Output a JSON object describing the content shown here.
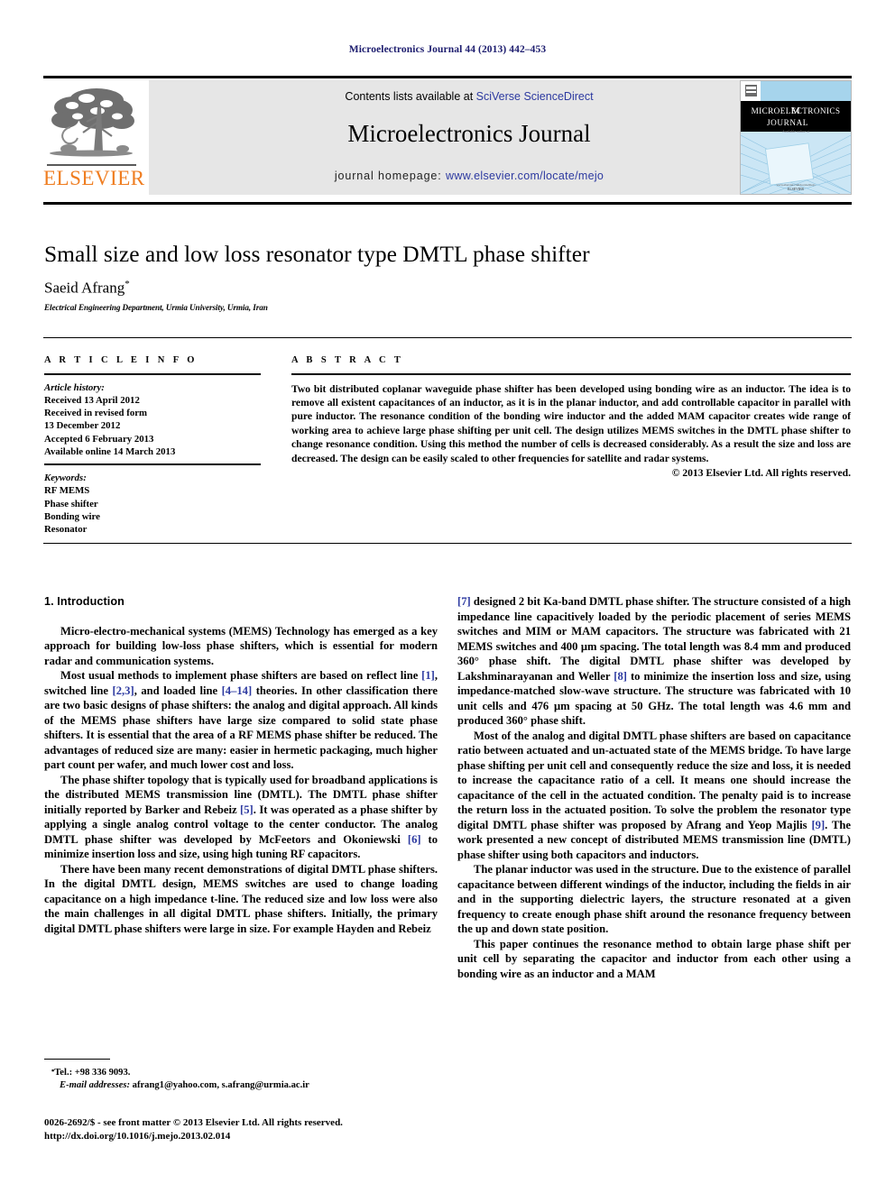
{
  "running_head": "Microelectronics Journal 44 (2013) 442–453",
  "masthead": {
    "publisher_name": "ELSEVIER",
    "contents_prefix": "Contents lists available at ",
    "contents_link": "SciVerse ScienceDirect",
    "journal_title": "Microelectronics Journal",
    "homepage_prefix": "journal homepage: ",
    "homepage_link": "www.elsevier.com/locate/mejo",
    "cover_title_line1": "MICROELECTRONICS",
    "cover_title_line2": "JOURNAL"
  },
  "article": {
    "title": "Small size and low loss resonator type DMTL phase shifter",
    "author": "Saeid Afrang",
    "author_marker": "*",
    "affiliation": "Electrical Engineering Department, Urmia University, Urmia, Iran"
  },
  "info": {
    "heading": "A R T I C L E   I N F O",
    "history_label": "Article history:",
    "history": [
      "Received 13 April 2012",
      "Received in revised form",
      "13 December 2012",
      "Accepted 6 February 2013",
      "Available online 14 March 2013"
    ],
    "keywords_label": "Keywords:",
    "keywords": [
      "RF MEMS",
      "Phase shifter",
      "Bonding wire",
      "Resonator"
    ]
  },
  "abstract": {
    "heading": "A B S T R A C T",
    "text": "Two bit distributed coplanar waveguide phase shifter has been developed using bonding wire as an inductor. The idea is to remove all existent capacitances of an inductor, as it is in the planar inductor, and add controllable capacitor in parallel with pure inductor. The resonance condition of the bonding wire inductor and the added MAM capacitor creates wide range of working area to achieve large phase shifting per unit cell. The design utilizes MEMS switches in the DMTL phase shifter to change resonance condition. Using this method the number of cells is decreased considerably. As a result the size and loss are decreased. The design can be easily scaled to other frequencies for satellite and radar systems.",
    "copyright": "© 2013 Elsevier Ltd. All rights reserved."
  },
  "body": {
    "section_number_title": "1.  Introduction",
    "left_paragraphs": [
      "Micro-electro-mechanical systems (MEMS) Technology has emerged as a key approach for building low-loss phase shifters, which is essential for modern radar and communication systems.",
      "Most usual methods to implement phase shifters are based on reflect line [1], switched line [2,3], and loaded line [4–14] theories. In other classification there are two basic designs of phase shifters: the analog and digital approach. All kinds of the MEMS phase shifters have large size compared to solid state phase shifters. It is essential that the area of a RF MEMS phase shifter be reduced. The advantages of reduced size are many: easier in hermetic packaging, much higher part count per wafer, and much lower cost and loss.",
      "The phase shifter topology that is typically used for broadband applications is the distributed MEMS transmission line (DMTL). The DMTL phase shifter initially reported by Barker and Rebeiz [5]. It was operated as a phase shifter by applying a single analog control voltage to the center conductor. The analog DMTL phase shifter was developed by McFeetors and Okoniewski [6] to minimize insertion loss and size, using high tuning RF capacitors.",
      "There have been many recent demonstrations of digital DMTL phase shifters. In the digital DMTL design, MEMS switches are used to change loading capacitance on a high impedance t-line. The reduced size and low loss were also the main challenges in all digital DMTL phase shifters. Initially, the primary digital DMTL phase shifters were large in size. For example Hayden and Rebeiz"
    ],
    "right_paragraphs": [
      "[7] designed 2 bit Ka-band DMTL phase shifter. The structure consisted of a high impedance line capacitively loaded by the periodic placement of series MEMS switches and MIM or MAM capacitors. The structure was fabricated with 21 MEMS switches and 400 μm spacing. The total length was 8.4 mm and produced 360° phase shift. The digital DMTL phase shifter was developed by Lakshminarayanan and Weller [8] to minimize the insertion loss and size, using impedance-matched slow-wave structure. The structure was fabricated with 10 unit cells and 476 μm spacing at 50 GHz. The total length was 4.6 mm and produced 360° phase shift.",
      "Most of the analog and digital DMTL phase shifters are based on capacitance ratio between actuated and un-actuated state of the MEMS bridge. To have large phase shifting per unit cell and consequently reduce the size and loss, it is needed to increase the capacitance ratio of a cell. It means one should increase the capacitance of the cell in the actuated condition. The penalty paid is to increase the return loss in the actuated position. To solve the problem the resonator type digital DMTL phase shifter was proposed by Afrang and Yeop Majlis [9]. The work presented a new concept of distributed MEMS transmission line (DMTL) phase shifter using both capacitors and inductors.",
      "The planar inductor was used in the structure. Due to the existence of parallel capacitance between different windings of the inductor, including the fields in air and in the supporting dielectric layers, the structure resonated at a given frequency to create enough phase shift around the resonance frequency between the up and down state position.",
      "This paper continues the resonance method to obtain large phase shift per unit cell by separating the capacitor and inductor from each other using a bonding wire as an inductor and a MAM"
    ]
  },
  "footnotes": {
    "tel": "Tel.: +98 336 9093.",
    "email_label": "E-mail addresses:",
    "emails": "afrang1@yahoo.com, s.afrang@urmia.ac.ir",
    "issn_line": "0026-2692/$ - see front matter © 2013 Elsevier Ltd. All rights reserved.",
    "doi_line": "http://dx.doi.org/10.1016/j.mejo.2013.02.014"
  },
  "colors": {
    "link": "#2c39a0",
    "running_head": "#1c1c6e",
    "elsevier_orange": "#ef7d20",
    "banner_bg": "#e6e6e6"
  }
}
